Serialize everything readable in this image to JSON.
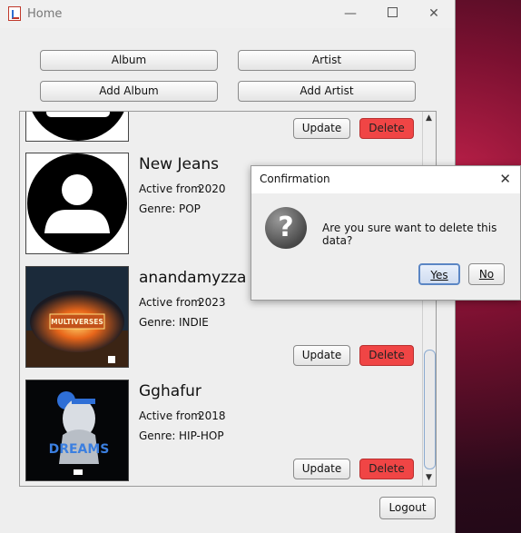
{
  "window": {
    "title": "Home"
  },
  "nav": {
    "album": "Album",
    "artist": "Artist",
    "add_album": "Add Album",
    "add_artist": "Add Artist"
  },
  "list": {
    "rows": [
      {
        "name": "",
        "active_label": "Active from",
        "year": "",
        "genre_label": "Genre:",
        "genre": "",
        "update": "Update",
        "delete": "Delete"
      },
      {
        "name": "New Jeans",
        "active_label": "Active from",
        "year": "2020",
        "genre_label": "Genre:",
        "genre": "POP",
        "update": "Update",
        "delete": "Delete"
      },
      {
        "name": "anandamyzza",
        "active_label": "Active from",
        "year": "2023",
        "genre_label": "Genre:",
        "genre": "INDIE",
        "update": "Update",
        "delete": "Delete"
      },
      {
        "name": "Gghafur",
        "active_label": "Active from",
        "year": "2018",
        "genre_label": "Genre:",
        "genre": "HIP-HOP",
        "update": "Update",
        "delete": "Delete"
      }
    ],
    "artwork_text": {
      "multiverses": "MULTIVERSES",
      "dreams": "DREAMS"
    }
  },
  "footer": {
    "logout": "Logout"
  },
  "dialog": {
    "title": "Confirmation",
    "message": "Are you sure want to delete this data?",
    "yes": "Yes",
    "no": "No",
    "icon": "question-icon"
  },
  "colors": {
    "delete_button": "#f04545",
    "window_bg": "#eeeeee"
  }
}
